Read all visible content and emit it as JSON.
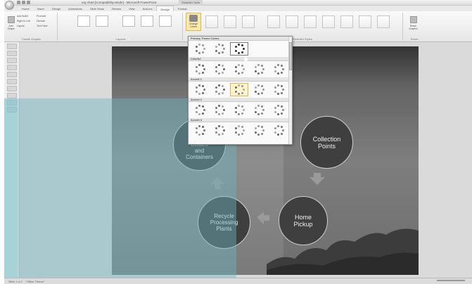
{
  "titlebar": {
    "title": "org chart [Compatibility Mode] - Microsoft PowerPoint",
    "context_tab_group": "SmartArt Tools"
  },
  "tabs": [
    "Home",
    "Insert",
    "Design",
    "Animations",
    "Slide Show",
    "Review",
    "View",
    "Add-Ins",
    "Design",
    "Format"
  ],
  "ribbon": {
    "create_graphic": {
      "group_label": "Create Graphic",
      "add_shape": "Add Shape",
      "add_bullet": "Add Bullet",
      "right_to_left": "Right to Left",
      "layout": "Layout",
      "promote": "Promote",
      "demote": "Demote",
      "text_pane": "Text Pane"
    },
    "layouts": {
      "group_label": "Layouts"
    },
    "styles": {
      "group_label": "SmartArt Styles",
      "change_colors": "Change Colors"
    },
    "reset": {
      "group_label": "Reset",
      "reset_graphic": "Reset Graphic"
    }
  },
  "dropdown": {
    "sections": [
      {
        "label": "Primary Theme Colors",
        "count": 3
      },
      {
        "label": "Colorful",
        "count": 5
      },
      {
        "label": "Accent 1",
        "count": 5
      },
      {
        "label": "Accent 2",
        "count": 5
      },
      {
        "label": "Accent 3",
        "count": 5
      }
    ]
  },
  "slide": {
    "circles": [
      {
        "id": "new-plastic-bottles",
        "text": "New\nPlastic\nBottles\nand\nContainers"
      },
      {
        "id": "collection-points",
        "text": "Collection\nPoints"
      },
      {
        "id": "home-pickup",
        "text": "Home\nPickup"
      },
      {
        "id": "recycle-plants",
        "text": "Recycle\nProcessing\nPlants"
      }
    ]
  },
  "status": {
    "slide": "Slide 1 of 1",
    "theme": "\"Office Theme\""
  },
  "colors": {
    "ribbon_bg": "#ececec",
    "highlight": "#ffe9a8",
    "teal_overlay": "#6eb4be"
  }
}
